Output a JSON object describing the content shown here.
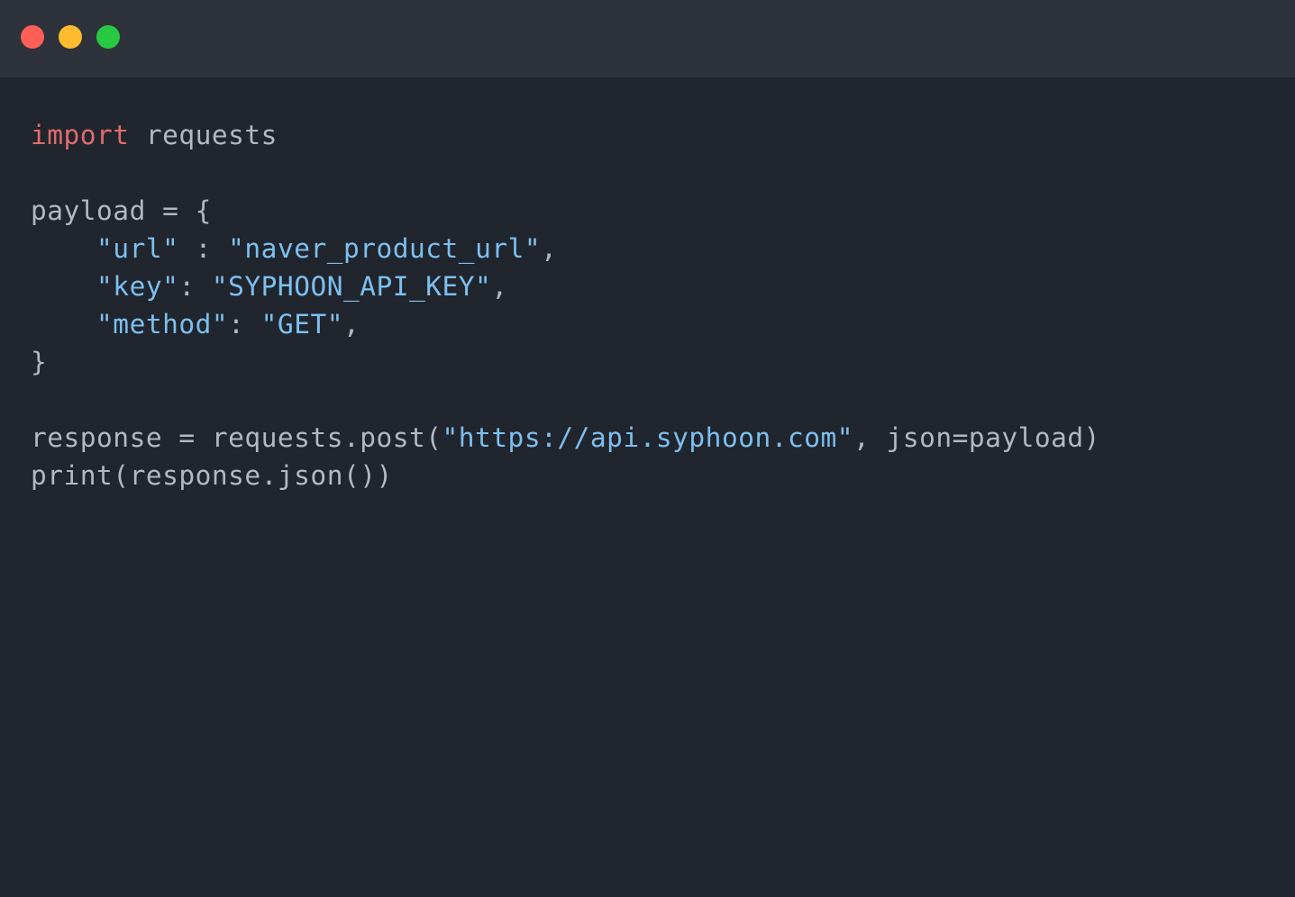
{
  "window": {
    "controls": [
      {
        "name": "close",
        "color": "#fe5f57"
      },
      {
        "name": "minimize",
        "color": "#febc2e"
      },
      {
        "name": "maximize",
        "color": "#28c840"
      }
    ]
  },
  "colors": {
    "background": "#21252d",
    "titlebar": "#2e323b",
    "keyword": "#e06c6c",
    "string": "#7cc0f0",
    "text": "#b3b8c2"
  },
  "code": {
    "language": "python",
    "lines": [
      [
        {
          "t": "kw",
          "v": "import"
        },
        {
          "t": "plain",
          "v": " requests"
        }
      ],
      [],
      [
        {
          "t": "plain",
          "v": "payload = {"
        }
      ],
      [
        {
          "t": "plain",
          "v": "    "
        },
        {
          "t": "str",
          "v": "\"url\""
        },
        {
          "t": "plain",
          "v": " : "
        },
        {
          "t": "str",
          "v": "\"naver_product_url\""
        },
        {
          "t": "plain",
          "v": ","
        }
      ],
      [
        {
          "t": "plain",
          "v": "    "
        },
        {
          "t": "str",
          "v": "\"key\""
        },
        {
          "t": "plain",
          "v": ": "
        },
        {
          "t": "str",
          "v": "\"SYPHOON_API_KEY\""
        },
        {
          "t": "plain",
          "v": ","
        }
      ],
      [
        {
          "t": "plain",
          "v": "    "
        },
        {
          "t": "str",
          "v": "\"method\""
        },
        {
          "t": "plain",
          "v": ": "
        },
        {
          "t": "str",
          "v": "\"GET\""
        },
        {
          "t": "plain",
          "v": ","
        }
      ],
      [
        {
          "t": "plain",
          "v": "}"
        }
      ],
      [],
      [
        {
          "t": "plain",
          "v": "response = requests.post("
        },
        {
          "t": "str",
          "v": "\"https://api.syphoon.com\""
        },
        {
          "t": "plain",
          "v": ", json=payload)"
        }
      ],
      [
        {
          "t": "plain",
          "v": "print(response.json())"
        }
      ]
    ]
  }
}
